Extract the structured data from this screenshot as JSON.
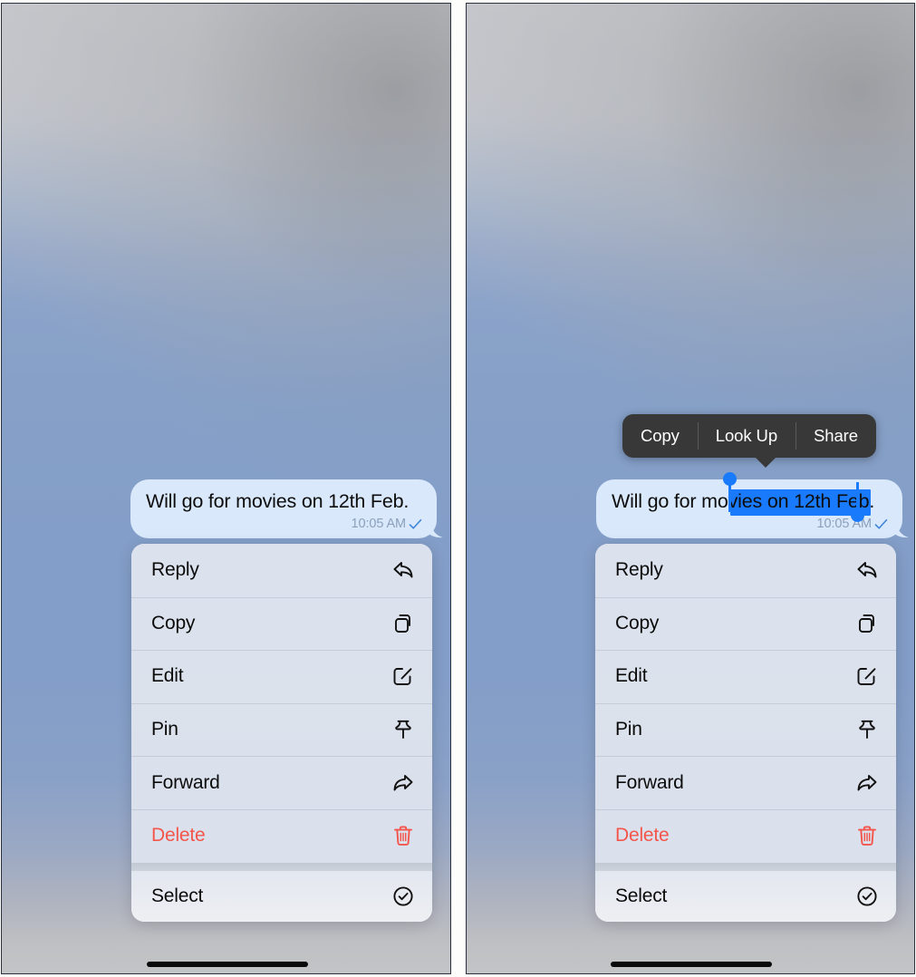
{
  "app": {
    "title": "iMessage conversation context menu"
  },
  "message": {
    "text": "Will go for movies on 12th Feb.",
    "time": "10:05 AM",
    "delivered_icon": "checkmark-icon",
    "bubble_color": "#d9e8fb",
    "text_color": "#0d0d0d",
    "time_color": "#8ba0ba"
  },
  "selection": {
    "selected_text": "movies on 12th",
    "prefix_text": "Will go for ",
    "suffix_text": " Feb.",
    "highlight_color": "#1a7afc",
    "handle_color": "#1a7afc"
  },
  "edit_menu": {
    "background": "#383838",
    "items": [
      {
        "label": "Copy",
        "name": "copy"
      },
      {
        "label": "Look Up",
        "name": "look-up"
      },
      {
        "label": "Share",
        "name": "share"
      }
    ]
  },
  "context_menu": {
    "background": "#dde3ee",
    "danger_color": "#f4554b",
    "primary_items": [
      {
        "label": "Reply",
        "icon": "reply-arrow-icon",
        "danger": false
      },
      {
        "label": "Copy",
        "icon": "copy-documents-icon",
        "danger": false
      },
      {
        "label": "Edit",
        "icon": "pencil-square-icon",
        "danger": false
      },
      {
        "label": "Pin",
        "icon": "pushpin-icon",
        "danger": false
      },
      {
        "label": "Forward",
        "icon": "forward-arrow-icon",
        "danger": false
      },
      {
        "label": "Delete",
        "icon": "trash-icon",
        "danger": true
      }
    ],
    "secondary_items": [
      {
        "label": "Select",
        "icon": "check-circle-icon",
        "danger": false
      }
    ]
  },
  "panels": [
    {
      "name": "left-screenshot",
      "selection_active": false,
      "edit_menu_visible": false
    },
    {
      "name": "right-screenshot",
      "selection_active": true,
      "edit_menu_visible": true
    }
  ],
  "home_indicator": {
    "color": "#0a0a0a"
  }
}
